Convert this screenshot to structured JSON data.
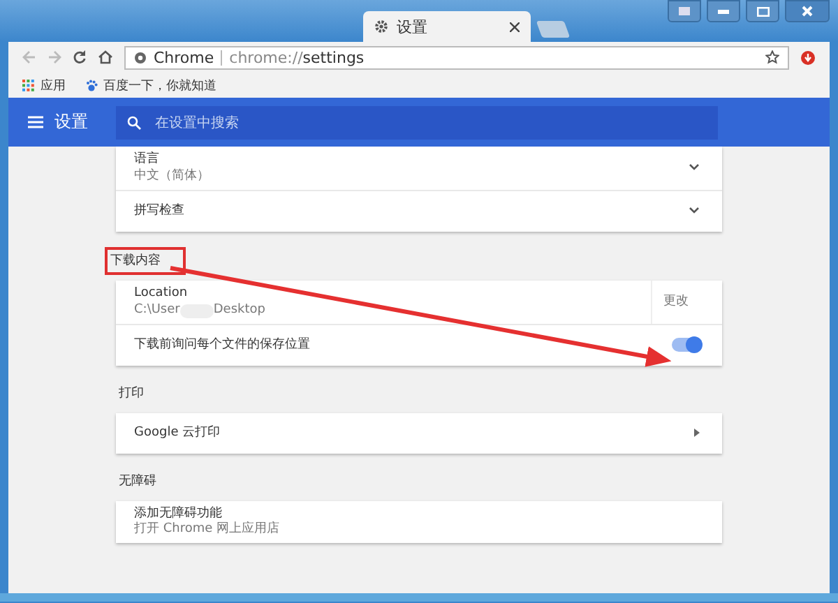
{
  "tabs": [
    {
      "label": "设置",
      "selected": true
    }
  ],
  "toolbar": {
    "site_label": "Chrome",
    "url_prefix": "chrome://",
    "url_path": "settings"
  },
  "bookmarks": [
    {
      "label": "应用",
      "kind": "apps"
    },
    {
      "label": "百度一下，你就知道",
      "kind": "paw"
    }
  ],
  "header": {
    "title": "设置",
    "search": {
      "placeholder": "在设置中搜索"
    }
  },
  "sections": [
    {
      "rows": [
        {
          "kind": "expand",
          "label": "语言",
          "secondary": "中文（简体）"
        },
        {
          "kind": "expand",
          "label": "拼写检查"
        }
      ]
    },
    {
      "title": "下载内容",
      "highlighted": true,
      "rows": [
        {
          "kind": "location",
          "label": "Location",
          "path_start": "C:\\User",
          "path_end": "Desktop",
          "redacted": true,
          "action": "更改"
        },
        {
          "kind": "toggle",
          "label": "下载前询问每个文件的保存位置",
          "on": true,
          "arrow_points_here": true
        }
      ]
    },
    {
      "title": "打印",
      "rows": [
        {
          "kind": "link",
          "label": "Google 云打印"
        }
      ]
    },
    {
      "title": "无障碍",
      "rows": [
        {
          "kind": "plain",
          "label": "添加无障碍功能",
          "secondary": "打开 Chrome 网上应用店"
        }
      ]
    }
  ]
}
